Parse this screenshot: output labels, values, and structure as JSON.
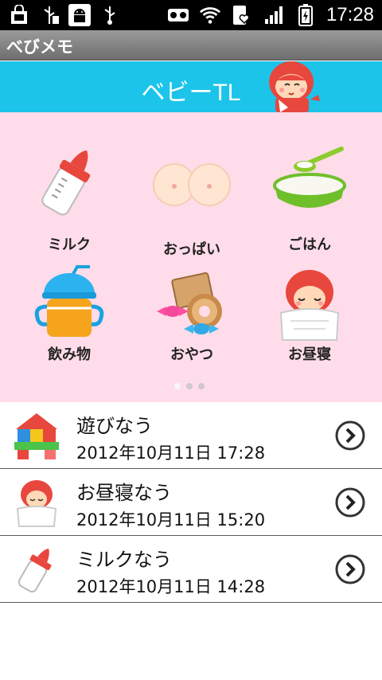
{
  "status": {
    "time": "17:28",
    "icons": [
      "bag-icon",
      "usb-icon",
      "android-debug-icon",
      "usb-icon",
      "voicemail-icon",
      "wifi-icon",
      "heart-phone-icon",
      "signal-icon",
      "battery-icon"
    ]
  },
  "appbar": {
    "title": "べびメモ"
  },
  "header": {
    "title": "ベビーTL"
  },
  "categories": [
    {
      "label": "ミルク",
      "icon": "milk-bottle-icon"
    },
    {
      "label": "おっぱい",
      "icon": "breast-icon"
    },
    {
      "label": "ごはん",
      "icon": "rice-bowl-icon"
    },
    {
      "label": "飲み物",
      "icon": "drink-cup-icon"
    },
    {
      "label": "おやつ",
      "icon": "snack-icon"
    },
    {
      "label": "お昼寝",
      "icon": "nap-icon"
    }
  ],
  "pager": {
    "pages": 3,
    "current": 1
  },
  "timeline": [
    {
      "title": "遊びなう",
      "time": "2012年10月11日 17:28",
      "icon": "blocks-icon"
    },
    {
      "title": "お昼寝なう",
      "time": "2012年10月11日 15:20",
      "icon": "nap-icon"
    },
    {
      "title": "ミルクなう",
      "time": "2012年10月11日 14:28",
      "icon": "milk-bottle-icon"
    }
  ],
  "colors": {
    "header": "#1cc4ea",
    "grid_bg": "#ffdce9",
    "hood_red": "#e8473e"
  }
}
